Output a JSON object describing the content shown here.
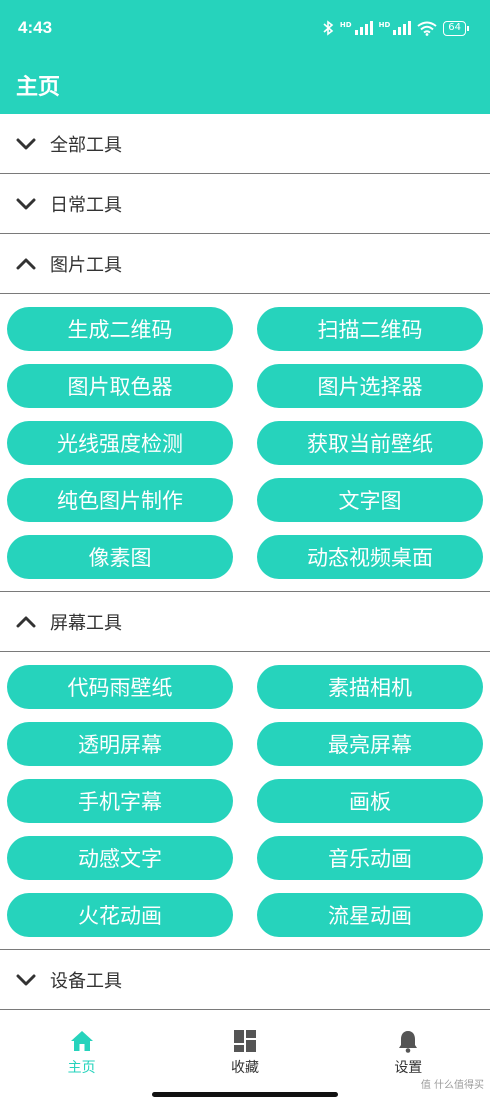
{
  "status": {
    "time": "4:43",
    "battery": "64"
  },
  "appbar": {
    "title": "主页"
  },
  "sections": [
    {
      "label": "全部工具",
      "expanded": false
    },
    {
      "label": "日常工具",
      "expanded": false
    },
    {
      "label": "图片工具",
      "expanded": true,
      "buttons": [
        "生成二维码",
        "扫描二维码",
        "图片取色器",
        "图片选择器",
        "光线强度检测",
        "获取当前壁纸",
        "纯色图片制作",
        "文字图",
        "像素图",
        "动态视频桌面"
      ]
    },
    {
      "label": "屏幕工具",
      "expanded": true,
      "buttons": [
        "代码雨壁纸",
        "素描相机",
        "透明屏幕",
        "最亮屏幕",
        "手机字幕",
        "画板",
        "动感文字",
        "音乐动画",
        "火花动画",
        "流星动画"
      ]
    },
    {
      "label": "设备工具",
      "expanded": false
    }
  ],
  "nav": [
    {
      "label": "主页",
      "icon": "home-icon",
      "active": true
    },
    {
      "label": "收藏",
      "icon": "grid-icon",
      "active": false
    },
    {
      "label": "设置",
      "icon": "bell-icon",
      "active": false
    }
  ],
  "watermark": "值 什么值得买",
  "colors": {
    "accent": "#26d3bc",
    "text": "#333333",
    "divider": "#7a7a7a"
  }
}
